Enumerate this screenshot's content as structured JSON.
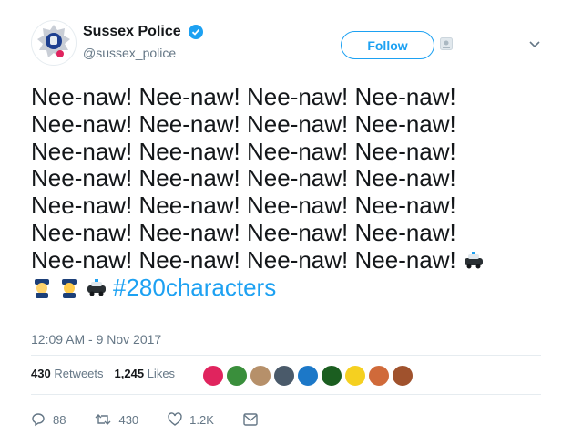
{
  "header": {
    "display_name": "Sussex Police",
    "handle": "@sussex_police",
    "follow_label": "Follow"
  },
  "tweet": {
    "text": "Nee-naw! Nee-naw! Nee-naw! Nee-naw!\nNee-naw! Nee-naw! Nee-naw! Nee-naw!\nNee-naw! Nee-naw! Nee-naw! Nee-naw!\nNee-naw! Nee-naw! Nee-naw! Nee-naw!\nNee-naw! Nee-naw! Nee-naw! Nee-naw!\nNee-naw! Nee-naw! Nee-naw! Nee-naw!\nNee-naw! Nee-naw! Nee-naw! Nee-naw! ",
    "hashtag": "#280characters",
    "timestamp": "12:09 AM - 9 Nov 2017"
  },
  "stats": {
    "retweets_count": "430",
    "retweets_label": "Retweets",
    "likes_count": "1,245",
    "likes_label": "Likes"
  },
  "actions": {
    "replies": "88",
    "retweets": "430",
    "likes": "1.2K"
  },
  "colors": {
    "accent": "#1da1f2",
    "text": "#14171a",
    "muted": "#657786",
    "divider": "#e6ecf0"
  }
}
